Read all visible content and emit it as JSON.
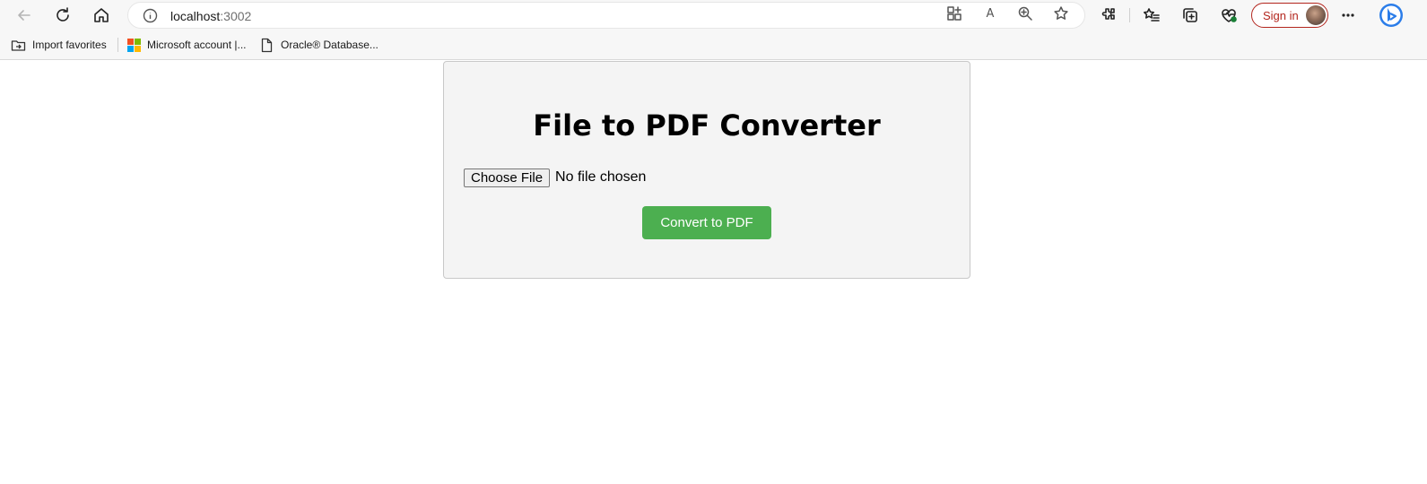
{
  "browser": {
    "address_bar": {
      "host": "localhost",
      "port": ":3002"
    },
    "sign_in_label": "Sign in",
    "favorites": [
      {
        "label": "Import favorites",
        "icon": "folder-import-icon"
      },
      {
        "label": "Microsoft account |...",
        "icon": "microsoft-logo-icon"
      },
      {
        "label": "Oracle® Database...",
        "icon": "page-icon"
      }
    ],
    "colors": {
      "toolbar_bg": "#f7f7f7",
      "sign_in_accent": "#b3261e"
    }
  },
  "page": {
    "title": "File to PDF Converter",
    "file_input": {
      "button_label": "Choose File",
      "status": "No file chosen"
    },
    "convert_button_label": "Convert to PDF",
    "colors": {
      "card_bg": "#f4f4f4",
      "convert_button": "#4caf50"
    }
  }
}
